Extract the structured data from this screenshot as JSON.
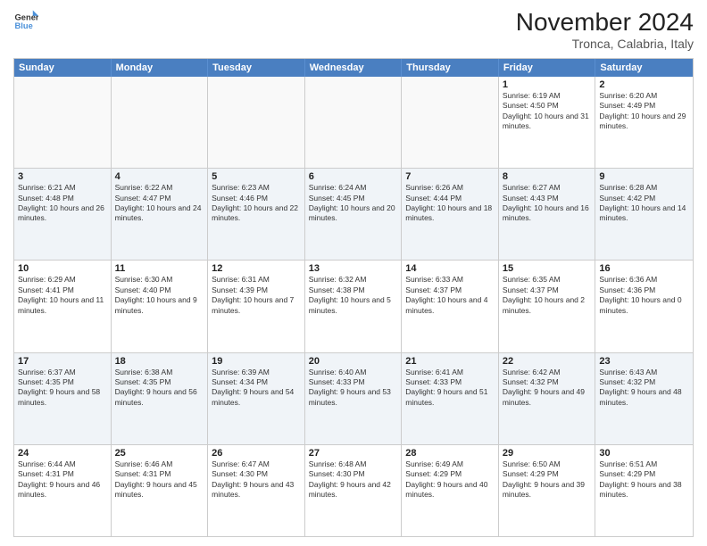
{
  "header": {
    "logo_line1": "General",
    "logo_line2": "Blue",
    "month": "November 2024",
    "location": "Tronca, Calabria, Italy"
  },
  "days": [
    "Sunday",
    "Monday",
    "Tuesday",
    "Wednesday",
    "Thursday",
    "Friday",
    "Saturday"
  ],
  "rows": [
    [
      {
        "day": "",
        "text": ""
      },
      {
        "day": "",
        "text": ""
      },
      {
        "day": "",
        "text": ""
      },
      {
        "day": "",
        "text": ""
      },
      {
        "day": "",
        "text": ""
      },
      {
        "day": "1",
        "text": "Sunrise: 6:19 AM\nSunset: 4:50 PM\nDaylight: 10 hours and 31 minutes."
      },
      {
        "day": "2",
        "text": "Sunrise: 6:20 AM\nSunset: 4:49 PM\nDaylight: 10 hours and 29 minutes."
      }
    ],
    [
      {
        "day": "3",
        "text": "Sunrise: 6:21 AM\nSunset: 4:48 PM\nDaylight: 10 hours and 26 minutes."
      },
      {
        "day": "4",
        "text": "Sunrise: 6:22 AM\nSunset: 4:47 PM\nDaylight: 10 hours and 24 minutes."
      },
      {
        "day": "5",
        "text": "Sunrise: 6:23 AM\nSunset: 4:46 PM\nDaylight: 10 hours and 22 minutes."
      },
      {
        "day": "6",
        "text": "Sunrise: 6:24 AM\nSunset: 4:45 PM\nDaylight: 10 hours and 20 minutes."
      },
      {
        "day": "7",
        "text": "Sunrise: 6:26 AM\nSunset: 4:44 PM\nDaylight: 10 hours and 18 minutes."
      },
      {
        "day": "8",
        "text": "Sunrise: 6:27 AM\nSunset: 4:43 PM\nDaylight: 10 hours and 16 minutes."
      },
      {
        "day": "9",
        "text": "Sunrise: 6:28 AM\nSunset: 4:42 PM\nDaylight: 10 hours and 14 minutes."
      }
    ],
    [
      {
        "day": "10",
        "text": "Sunrise: 6:29 AM\nSunset: 4:41 PM\nDaylight: 10 hours and 11 minutes."
      },
      {
        "day": "11",
        "text": "Sunrise: 6:30 AM\nSunset: 4:40 PM\nDaylight: 10 hours and 9 minutes."
      },
      {
        "day": "12",
        "text": "Sunrise: 6:31 AM\nSunset: 4:39 PM\nDaylight: 10 hours and 7 minutes."
      },
      {
        "day": "13",
        "text": "Sunrise: 6:32 AM\nSunset: 4:38 PM\nDaylight: 10 hours and 5 minutes."
      },
      {
        "day": "14",
        "text": "Sunrise: 6:33 AM\nSunset: 4:37 PM\nDaylight: 10 hours and 4 minutes."
      },
      {
        "day": "15",
        "text": "Sunrise: 6:35 AM\nSunset: 4:37 PM\nDaylight: 10 hours and 2 minutes."
      },
      {
        "day": "16",
        "text": "Sunrise: 6:36 AM\nSunset: 4:36 PM\nDaylight: 10 hours and 0 minutes."
      }
    ],
    [
      {
        "day": "17",
        "text": "Sunrise: 6:37 AM\nSunset: 4:35 PM\nDaylight: 9 hours and 58 minutes."
      },
      {
        "day": "18",
        "text": "Sunrise: 6:38 AM\nSunset: 4:35 PM\nDaylight: 9 hours and 56 minutes."
      },
      {
        "day": "19",
        "text": "Sunrise: 6:39 AM\nSunset: 4:34 PM\nDaylight: 9 hours and 54 minutes."
      },
      {
        "day": "20",
        "text": "Sunrise: 6:40 AM\nSunset: 4:33 PM\nDaylight: 9 hours and 53 minutes."
      },
      {
        "day": "21",
        "text": "Sunrise: 6:41 AM\nSunset: 4:33 PM\nDaylight: 9 hours and 51 minutes."
      },
      {
        "day": "22",
        "text": "Sunrise: 6:42 AM\nSunset: 4:32 PM\nDaylight: 9 hours and 49 minutes."
      },
      {
        "day": "23",
        "text": "Sunrise: 6:43 AM\nSunset: 4:32 PM\nDaylight: 9 hours and 48 minutes."
      }
    ],
    [
      {
        "day": "24",
        "text": "Sunrise: 6:44 AM\nSunset: 4:31 PM\nDaylight: 9 hours and 46 minutes."
      },
      {
        "day": "25",
        "text": "Sunrise: 6:46 AM\nSunset: 4:31 PM\nDaylight: 9 hours and 45 minutes."
      },
      {
        "day": "26",
        "text": "Sunrise: 6:47 AM\nSunset: 4:30 PM\nDaylight: 9 hours and 43 minutes."
      },
      {
        "day": "27",
        "text": "Sunrise: 6:48 AM\nSunset: 4:30 PM\nDaylight: 9 hours and 42 minutes."
      },
      {
        "day": "28",
        "text": "Sunrise: 6:49 AM\nSunset: 4:29 PM\nDaylight: 9 hours and 40 minutes."
      },
      {
        "day": "29",
        "text": "Sunrise: 6:50 AM\nSunset: 4:29 PM\nDaylight: 9 hours and 39 minutes."
      },
      {
        "day": "30",
        "text": "Sunrise: 6:51 AM\nSunset: 4:29 PM\nDaylight: 9 hours and 38 minutes."
      }
    ]
  ]
}
